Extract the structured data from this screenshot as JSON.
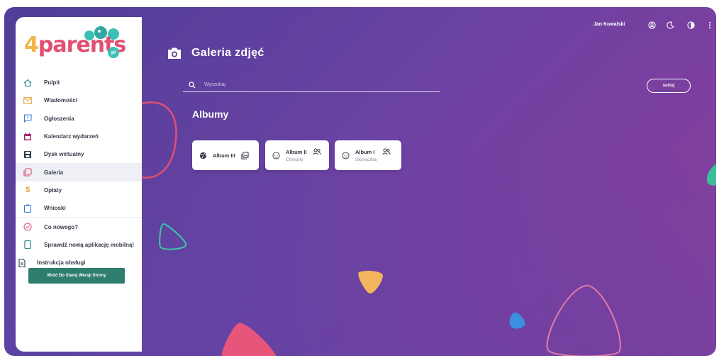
{
  "app": {
    "logo_text_number": "4",
    "logo_text_rest": "parents",
    "logo_suffix": "pl"
  },
  "header": {
    "user_name": "Jan Kowalski",
    "icons": [
      "user-circle-icon",
      "moon-icon",
      "contrast-icon",
      "more-vertical-icon"
    ]
  },
  "sidebar": {
    "items": [
      {
        "label": "Pulpit",
        "icon": "home-icon",
        "color": "#2f8f86"
      },
      {
        "label": "Wiadomości",
        "icon": "envelope-icon",
        "color": "#e4a23a"
      },
      {
        "label": "Ogłoszenia",
        "icon": "message-icon",
        "color": "#3b7fd6"
      },
      {
        "label": "Kalendarz wydarzeń",
        "icon": "calendar-icon",
        "color": "#a12a6c"
      },
      {
        "label": "Dysk wirtualny",
        "icon": "save-icon",
        "color": "#2b3c52"
      },
      {
        "label": "Galeria",
        "icon": "gallery-icon",
        "color": "#d9466a",
        "active": true
      },
      {
        "label": "Opłaty",
        "icon": "dollar-icon",
        "color": "#e4a23a"
      },
      {
        "label": "Wnioski",
        "icon": "clipboard-icon",
        "color": "#3b7fd6"
      },
      {
        "label": "Co nowego?",
        "icon": "badge-icon",
        "color": "#e24f71"
      },
      {
        "label": "Sprawdź nową aplikację mobilną!",
        "icon": "phone-icon",
        "color": "#2f8f86"
      },
      {
        "label": "Instrukcja obsługi",
        "icon": "document-icon",
        "color": "#2b3c52"
      }
    ],
    "old_version_label": "Wróć Do Starej Wersji Strony"
  },
  "main": {
    "page_title": "Galeria zdjęć",
    "search_placeholder": "Wyszukaj",
    "sort_label": "sortuj",
    "albums_title": "Albumy",
    "albums": [
      {
        "name": "Album III",
        "subtitle": "",
        "icon": "globe-icon",
        "trail_icon": "images-icon"
      },
      {
        "name": "Album II",
        "subtitle": "Chmurki",
        "icon": "group-face-icon",
        "trail_icon": "users-icon"
      },
      {
        "name": "Album I",
        "subtitle": "Słoneczka",
        "icon": "group-face-icon",
        "trail_icon": "users-icon"
      }
    ]
  },
  "colors": {
    "bg_start": "#4f3e98",
    "bg_end": "#8a3f9c",
    "button_green": "#2f7d6d",
    "active_bg": "#eef0f6"
  }
}
